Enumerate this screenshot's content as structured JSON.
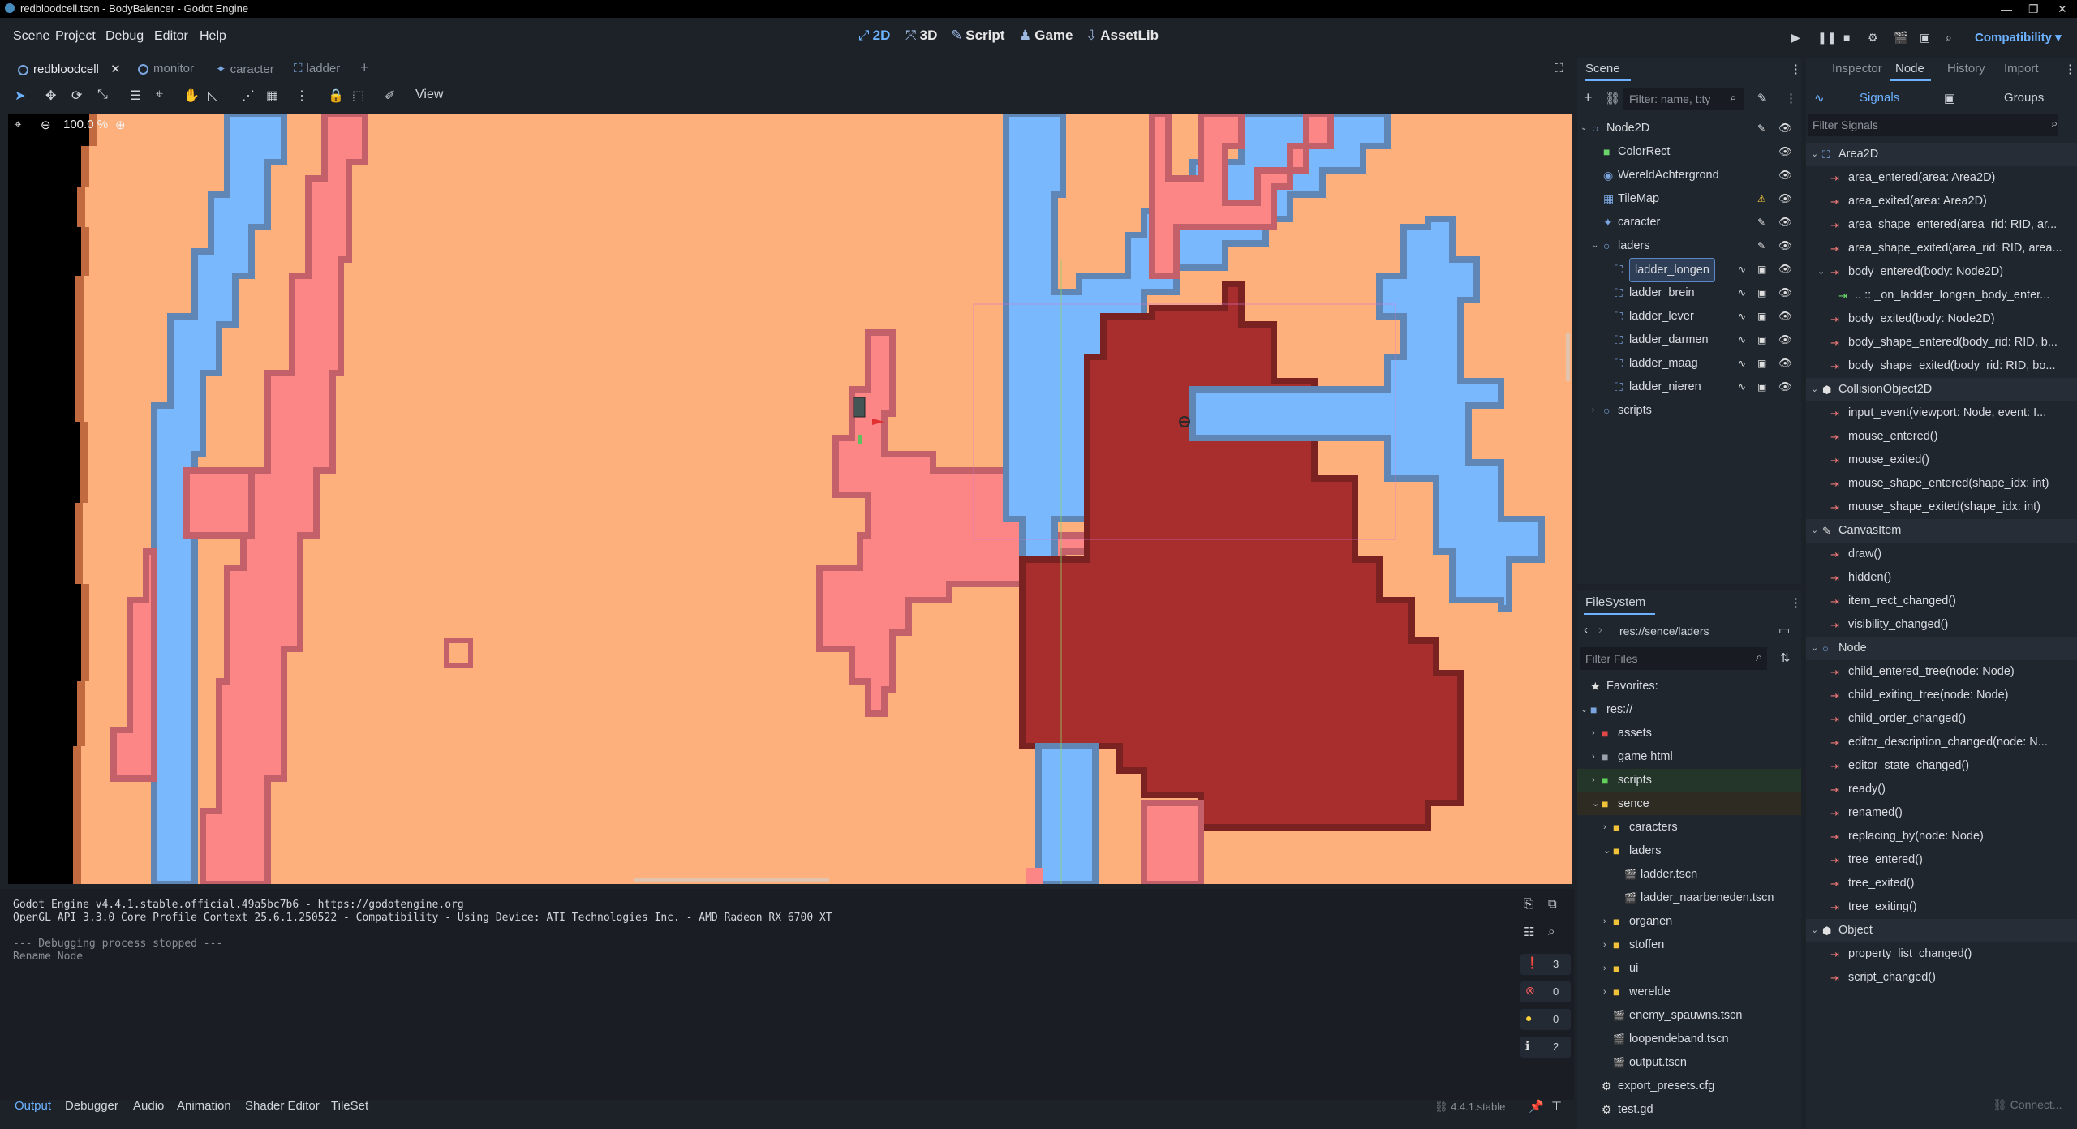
{
  "window": {
    "title": "redbloodcell.tscn - BodyBalencer - Godot Engine"
  },
  "menu": [
    "Scene",
    "Project",
    "Debug",
    "Editor",
    "Help"
  ],
  "workspaces": [
    {
      "label": "2D",
      "icon": "2d-icon",
      "active": true
    },
    {
      "label": "3D",
      "icon": "3d-icon",
      "active": false
    },
    {
      "label": "Script",
      "icon": "script-icon",
      "active": false
    },
    {
      "label": "Game",
      "icon": "game-icon",
      "active": false
    },
    {
      "label": "AssetLib",
      "icon": "assetlib-icon",
      "active": false
    }
  ],
  "renderer": "Compatibility",
  "scene_tabs": [
    {
      "label": "redbloodcell",
      "active": true
    },
    {
      "label": "monitor",
      "active": false
    },
    {
      "label": "caracter",
      "active": false
    },
    {
      "label": "ladder",
      "active": false
    }
  ],
  "toolbar": {
    "view_label": "View"
  },
  "viewport": {
    "zoom": "100.0 %",
    "colors": {
      "background": "#fdaf7c",
      "pink": "#fc8585",
      "pink_outline": "#c4606a",
      "blue": "#79b8fc",
      "blue_outline": "#5f86b4",
      "dark_red": "#a82d2d",
      "black": "#000000"
    }
  },
  "output": {
    "lines": [
      "Godot Engine v4.4.1.stable.official.49a5bc7b6 - https://godotengine.org",
      "OpenGL API 3.3.0 Core Profile Context 25.6.1.250522 - Compatibility - Using Device: ATI Technologies Inc. - AMD Radeon RX 6700 XT",
      "",
      "--- Debugging process stopped ---",
      "Rename Node"
    ],
    "counts": {
      "messages": "3",
      "errors": "0",
      "warnings": "0",
      "info": "2"
    }
  },
  "bottom_tabs": [
    "Output",
    "Debugger",
    "Audio",
    "Animation",
    "Shader Editor",
    "TileSet"
  ],
  "version": "4.4.1.stable",
  "scene_dock": {
    "title": "Scene",
    "filter_placeholder": "Filter: name, t:ty",
    "tree": [
      {
        "label": "Node2D",
        "icon": "node2d-icon",
        "indent": 0
      },
      {
        "label": "ColorRect",
        "icon": "colorrect-icon",
        "indent": 1
      },
      {
        "label": "WereldAchtergrond",
        "icon": "sprite-icon",
        "indent": 1
      },
      {
        "label": "TileMap",
        "icon": "tilemap-icon",
        "indent": 1,
        "warning": true
      },
      {
        "label": "caracter",
        "icon": "character-icon",
        "indent": 1
      },
      {
        "label": "laders",
        "icon": "node2d-icon",
        "indent": 1
      },
      {
        "label": "ladder_longen",
        "icon": "area2d-icon",
        "indent": 2,
        "selected": true
      },
      {
        "label": "ladder_brein",
        "icon": "area2d-icon",
        "indent": 2
      },
      {
        "label": "ladder_lever",
        "icon": "area2d-icon",
        "indent": 2
      },
      {
        "label": "ladder_darmen",
        "icon": "area2d-icon",
        "indent": 2
      },
      {
        "label": "ladder_maag",
        "icon": "area2d-icon",
        "indent": 2
      },
      {
        "label": "ladder_nieren",
        "icon": "area2d-icon",
        "indent": 2
      },
      {
        "label": "scripts",
        "icon": "node2d-icon",
        "indent": 1
      }
    ]
  },
  "filesystem": {
    "title": "FileSystem",
    "path": "res://sence/laders",
    "filter_placeholder": "Filter Files",
    "items": [
      {
        "label": "Favorites:",
        "icon": "star-icon",
        "indent": 0
      },
      {
        "label": "res://",
        "icon": "folder-icon",
        "indent": 0
      },
      {
        "label": "assets",
        "icon": "folder-icon",
        "indent": 1,
        "color": "#e04848"
      },
      {
        "label": "game html",
        "icon": "folder-icon",
        "indent": 1,
        "color": "#9aa3ad"
      },
      {
        "label": "scripts",
        "icon": "folder-icon",
        "indent": 1,
        "color": "#5fd05a"
      },
      {
        "label": "sence",
        "icon": "folder-icon",
        "indent": 1,
        "color": "#f0c23a"
      },
      {
        "label": "caracters",
        "icon": "folder-icon",
        "indent": 2,
        "color": "#f0c23a"
      },
      {
        "label": "laders",
        "icon": "folder-icon",
        "indent": 2,
        "color": "#f0c23a"
      },
      {
        "label": "ladder.tscn",
        "icon": "scene-file-icon",
        "indent": 3
      },
      {
        "label": "ladder_naarbeneden.tscn",
        "icon": "scene-file-icon",
        "indent": 3
      },
      {
        "label": "organen",
        "icon": "folder-icon",
        "indent": 2,
        "color": "#f0c23a"
      },
      {
        "label": "stoffen",
        "icon": "folder-icon",
        "indent": 2,
        "color": "#f0c23a"
      },
      {
        "label": "ui",
        "icon": "folder-icon",
        "indent": 2,
        "color": "#f0c23a"
      },
      {
        "label": "werelde",
        "icon": "folder-icon",
        "indent": 2,
        "color": "#f0c23a"
      },
      {
        "label": "enemy_spauwns.tscn",
        "icon": "scene-file-icon",
        "indent": 2
      },
      {
        "label": "loopendeband.tscn",
        "icon": "scene-file-icon",
        "indent": 2
      },
      {
        "label": "output.tscn",
        "icon": "scene-file-icon",
        "indent": 2
      },
      {
        "label": "export_presets.cfg",
        "icon": "gear-icon",
        "indent": 1
      },
      {
        "label": "test.gd",
        "icon": "gear-icon",
        "indent": 1
      }
    ]
  },
  "node_dock": {
    "tabs": [
      "Inspector",
      "Node",
      "History",
      "Import"
    ],
    "subtabs": [
      "Signals",
      "Groups"
    ],
    "filter_placeholder": "Filter Signals",
    "signals": [
      {
        "kind": "class",
        "label": "Area2D"
      },
      {
        "kind": "signal",
        "label": "area_entered(area: Area2D)"
      },
      {
        "kind": "signal",
        "label": "area_exited(area: Area2D)"
      },
      {
        "kind": "signal",
        "label": "area_shape_entered(area_rid: RID, ar..."
      },
      {
        "kind": "signal",
        "label": "area_shape_exited(area_rid: RID, area..."
      },
      {
        "kind": "signal",
        "label": "body_entered(body: Node2D)",
        "expanded": true
      },
      {
        "kind": "connection",
        "label": ".. :: _on_ladder_longen_body_enter..."
      },
      {
        "kind": "signal",
        "label": "body_exited(body: Node2D)"
      },
      {
        "kind": "signal",
        "label": "body_shape_entered(body_rid: RID, b..."
      },
      {
        "kind": "signal",
        "label": "body_shape_exited(body_rid: RID, bo..."
      },
      {
        "kind": "class",
        "label": "CollisionObject2D"
      },
      {
        "kind": "signal",
        "label": "input_event(viewport: Node, event: I..."
      },
      {
        "kind": "signal",
        "label": "mouse_entered()"
      },
      {
        "kind": "signal",
        "label": "mouse_exited()"
      },
      {
        "kind": "signal",
        "label": "mouse_shape_entered(shape_idx: int)"
      },
      {
        "kind": "signal",
        "label": "mouse_shape_exited(shape_idx: int)"
      },
      {
        "kind": "class",
        "label": "CanvasItem"
      },
      {
        "kind": "signal",
        "label": "draw()"
      },
      {
        "kind": "signal",
        "label": "hidden()"
      },
      {
        "kind": "signal",
        "label": "item_rect_changed()"
      },
      {
        "kind": "signal",
        "label": "visibility_changed()"
      },
      {
        "kind": "class",
        "label": "Node"
      },
      {
        "kind": "signal",
        "label": "child_entered_tree(node: Node)"
      },
      {
        "kind": "signal",
        "label": "child_exiting_tree(node: Node)"
      },
      {
        "kind": "signal",
        "label": "child_order_changed()"
      },
      {
        "kind": "signal",
        "label": "editor_description_changed(node: N..."
      },
      {
        "kind": "signal",
        "label": "editor_state_changed()"
      },
      {
        "kind": "signal",
        "label": "ready()"
      },
      {
        "kind": "signal",
        "label": "renamed()"
      },
      {
        "kind": "signal",
        "label": "replacing_by(node: Node)"
      },
      {
        "kind": "signal",
        "label": "tree_entered()"
      },
      {
        "kind": "signal",
        "label": "tree_exited()"
      },
      {
        "kind": "signal",
        "label": "tree_exiting()"
      },
      {
        "kind": "class",
        "label": "Object"
      },
      {
        "kind": "signal",
        "label": "property_list_changed()"
      },
      {
        "kind": "signal",
        "label": "script_changed()"
      }
    ],
    "connect_label": "Connect..."
  }
}
